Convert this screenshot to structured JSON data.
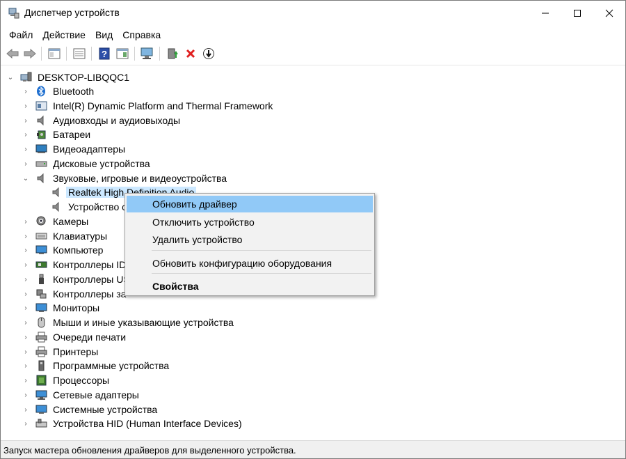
{
  "window": {
    "title": "Диспетчер устройств"
  },
  "menu": [
    "Файл",
    "Действие",
    "Вид",
    "Справка"
  ],
  "toolbar": [
    "back-icon",
    "forward-icon",
    "properties-icon",
    "details-icon",
    "help-icon",
    "view-icon",
    "scan-icon",
    "update-driver-icon",
    "uninstall-icon",
    "disable-icon"
  ],
  "tree": {
    "root": "DESKTOP-LIBQQC1",
    "items": [
      "Bluetooth",
      "Intel(R) Dynamic Platform and Thermal Framework",
      "Аудиовходы и аудиовыходы",
      "Батареи",
      "Видеоадаптеры",
      "Дисковые устройства",
      "Звуковые, игровые и видеоустройства",
      "Realtek High Definition Audio",
      "Устройство с",
      "Камеры",
      "Клавиатуры",
      "Компьютер",
      "Контроллеры IDI",
      "Контроллеры US",
      "Контроллеры за",
      "Мониторы",
      "Мыши и иные указывающие устройства",
      "Очереди печати",
      "Принтеры",
      "Программные устройства",
      "Процессоры",
      "Сетевые адаптеры",
      "Системные устройства",
      "Устройства HID (Human Interface Devices)"
    ]
  },
  "context_menu": {
    "update": "Обновить драйвер",
    "disable": "Отключить устройство",
    "uninstall": "Удалить устройство",
    "scan": "Обновить конфигурацию оборудования",
    "properties": "Свойства"
  },
  "status": "Запуск мастера обновления драйверов для выделенного устройства.",
  "colors": {
    "selection": "#cce8ff",
    "menu_highlight": "#91c9f7"
  }
}
